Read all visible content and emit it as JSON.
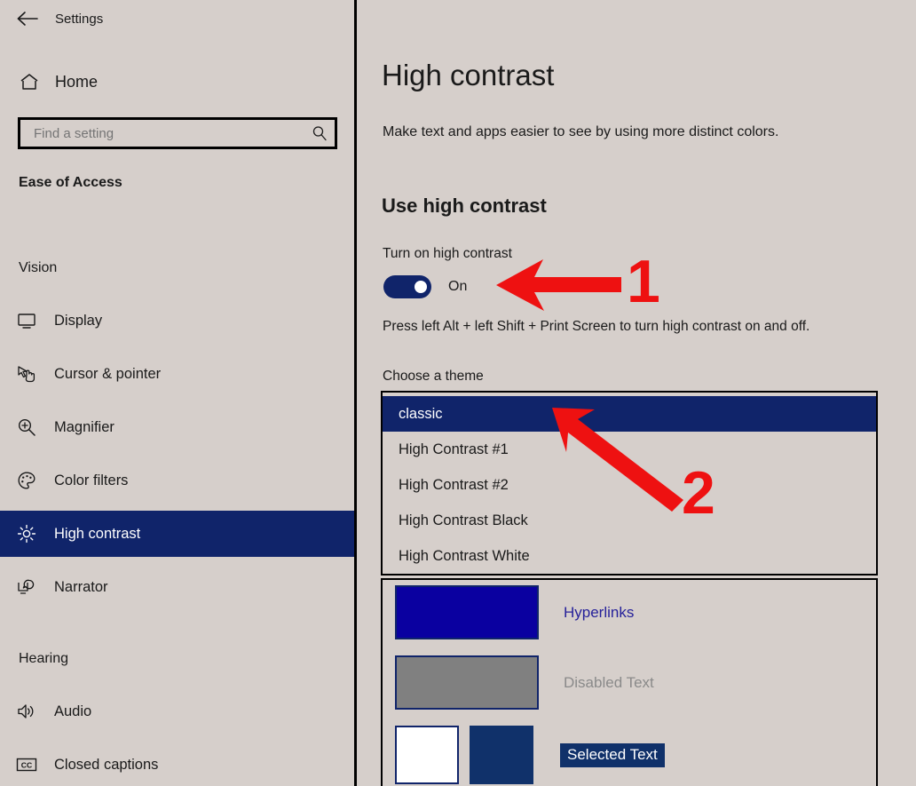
{
  "window": {
    "title": "Settings",
    "back_icon": "back-arrow-icon"
  },
  "sidebar": {
    "home": {
      "label": "Home",
      "icon": "home-icon"
    },
    "search": {
      "value": "",
      "placeholder": "Find a setting",
      "icon": "search-icon"
    },
    "app_name": "Ease of Access",
    "groups": [
      {
        "label": "Vision"
      },
      {
        "label": "Hearing"
      }
    ],
    "items": [
      {
        "label": "Display",
        "icon": "monitor-icon",
        "selected": false
      },
      {
        "label": "Cursor & pointer",
        "icon": "cursor-pointer-icon",
        "selected": false
      },
      {
        "label": "Magnifier",
        "icon": "magnifier-icon",
        "selected": false
      },
      {
        "label": "Color filters",
        "icon": "palette-icon",
        "selected": false
      },
      {
        "label": "High contrast",
        "icon": "sun-brightness-icon",
        "selected": true
      },
      {
        "label": "Narrator",
        "icon": "narrator-icon",
        "selected": false
      },
      {
        "label": "Audio",
        "icon": "speaker-icon",
        "selected": false
      },
      {
        "label": "Closed captions",
        "icon": "closed-captions-icon",
        "selected": false
      }
    ]
  },
  "main": {
    "title": "High contrast",
    "subtitle": "Make text and apps easier to see by using more distinct colors.",
    "section_title": "Use high contrast",
    "toggle": {
      "label": "Turn on high contrast",
      "state": "On",
      "checked": true
    },
    "hint": "Press left Alt + left Shift + Print Screen to turn high contrast on and off.",
    "theme_chooser": {
      "label": "Choose a theme",
      "selected": "classic",
      "options": [
        "classic",
        "High Contrast #1",
        "High Contrast #2",
        "High Contrast Black",
        "High Contrast White"
      ]
    },
    "preview": {
      "rows": [
        {
          "label": "Hyperlinks",
          "swatch": "#0a00a0"
        },
        {
          "label": "Disabled Text",
          "swatch": "#808080"
        },
        {
          "label": "Selected Text",
          "swatch": "#10316a"
        }
      ]
    }
  },
  "annotations": {
    "color": "#ee1111",
    "markers": [
      {
        "number": "1",
        "points_to": "high-contrast-toggle"
      },
      {
        "number": "2",
        "points_to": "theme-option-classic"
      }
    ]
  },
  "colors": {
    "background": "#d6cfcb",
    "accent_navy": "#10246a",
    "hyperlink_blue": "#0a00a0",
    "disabled_gray": "#808080",
    "annotation_red": "#ee1111"
  }
}
